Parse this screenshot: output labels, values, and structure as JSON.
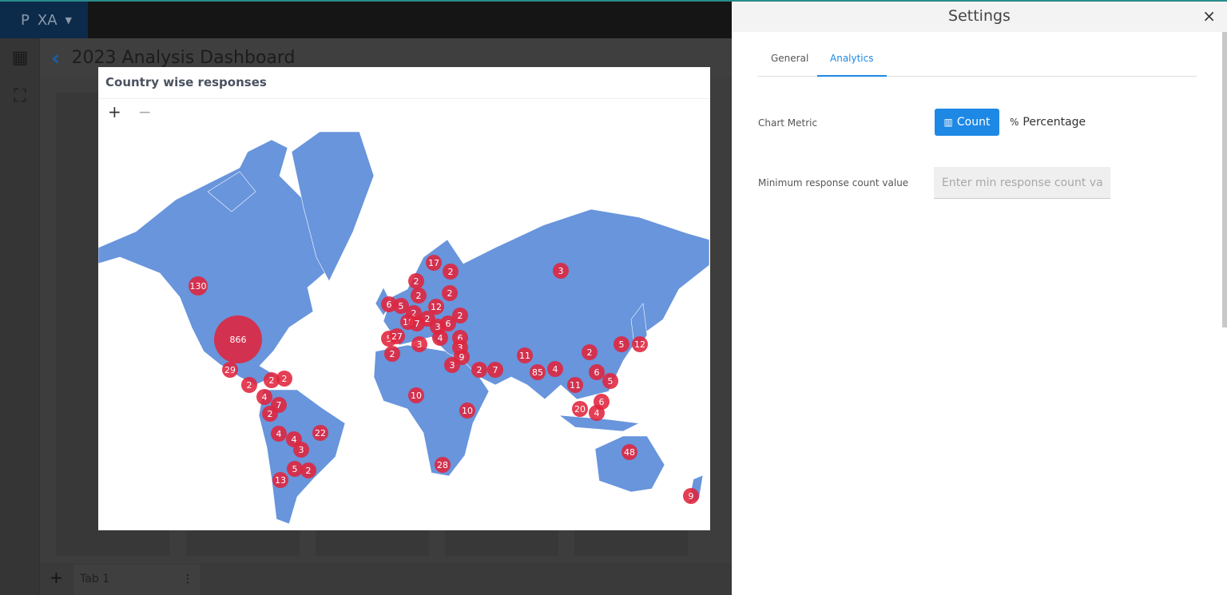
{
  "app": {
    "logo": "P",
    "workspace": "XA",
    "dashboard_title": "2023 Analysis Dashboard",
    "tab_label": "Tab 1",
    "add_tab": "+"
  },
  "widget": {
    "title": "Country wise responses",
    "zoom_in": "+",
    "zoom_out": "−",
    "colors": {
      "land": "#6895dc",
      "marker": "#e0243c"
    },
    "markers": [
      "130",
      "866",
      "29",
      "2",
      "2",
      "2",
      "4",
      "7",
      "2",
      "4",
      "4",
      "3",
      "22",
      "5",
      "2",
      "13",
      "17",
      "2",
      "2",
      "2",
      "2",
      "6",
      "5",
      "12",
      "2",
      "2",
      "18",
      "7",
      "3",
      "6",
      "2",
      "5",
      "27",
      "4",
      "3",
      "6",
      "3",
      "9",
      "2",
      "3",
      "2",
      "7",
      "11",
      "85",
      "4",
      "2",
      "5",
      "12",
      "6",
      "5",
      "11",
      "20",
      "6",
      "4",
      "10",
      "10",
      "28",
      "48",
      "9",
      "3"
    ]
  },
  "settings": {
    "title": "Settings",
    "close": "×",
    "tabs": [
      {
        "label": "General"
      },
      {
        "label": "Analytics"
      }
    ],
    "chart_metric_label": "Chart Metric",
    "count_label": "Count",
    "percentage_label": "Percentage",
    "min_count_label": "Minimum response count value",
    "min_count_placeholder": "Enter min response count val",
    "accent": "#1e88e5"
  }
}
